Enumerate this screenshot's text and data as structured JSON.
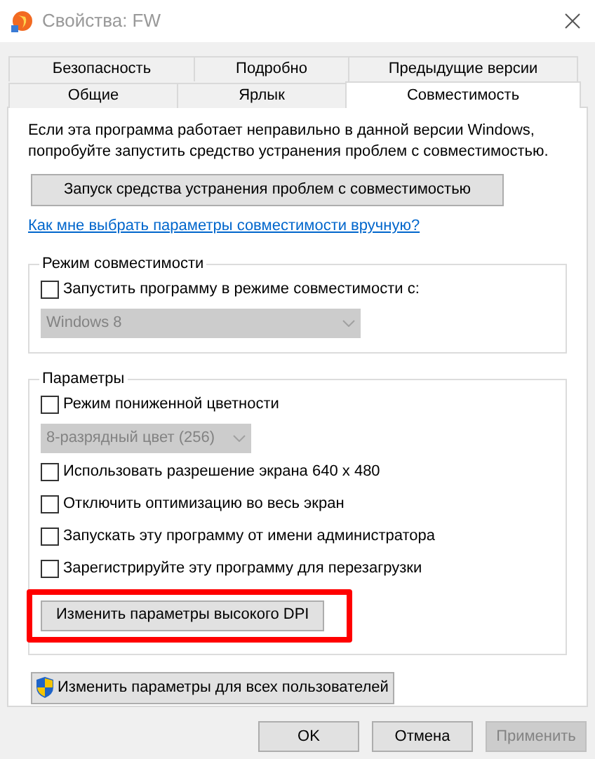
{
  "window": {
    "title": "Свойства: FW"
  },
  "tab_rows": [
    [
      {
        "label": "Безопасность",
        "selected": false
      },
      {
        "label": "Подробно",
        "selected": false
      },
      {
        "label": "Предыдущие версии",
        "selected": false
      }
    ],
    [
      {
        "label": "Общие",
        "selected": false
      },
      {
        "label": "Ярлык",
        "selected": false
      },
      {
        "label": "Совместимость",
        "selected": true
      }
    ]
  ],
  "intro": "Если эта программа работает неправильно в данной версии Windows, попробуйте запустить средство устранения проблем с совместимостью.",
  "troubleshooter_button": "Запуск средства устранения проблем с совместимостью",
  "help_link": "Как мне выбрать параметры совместимости вручную?",
  "compat_group": {
    "title": "Режим совместимости",
    "items": [
      {
        "kind": "checkbox",
        "label": "Запустить программу в режиме совместимости с:",
        "checked": false
      },
      {
        "kind": "dropdown",
        "value": "Windows 8",
        "disabled": true,
        "wide": true
      }
    ]
  },
  "settings_group": {
    "title": "Параметры",
    "items": [
      {
        "kind": "checkbox",
        "label": "Режим пониженной цветности",
        "checked": false
      },
      {
        "kind": "dropdown",
        "value": "8-разрядный цвет (256)",
        "disabled": true,
        "wide": false
      },
      {
        "kind": "checkbox",
        "label": "Использовать разрешение экрана 640 x 480",
        "checked": false
      },
      {
        "kind": "checkbox",
        "label": "Отключить оптимизацию во весь экран",
        "checked": false
      },
      {
        "kind": "checkbox",
        "label": "Запускать эту программу от имени администратора",
        "checked": false
      },
      {
        "kind": "checkbox",
        "label": "Зарегистрируйте эту программу для перезагрузки",
        "checked": false
      },
      {
        "kind": "button",
        "label": "Изменить параметры высокого DPI",
        "highlighted": true
      }
    ]
  },
  "all_users_button": "Изменить параметры для всех пользователей",
  "buttons": [
    {
      "label": "OK",
      "disabled": false
    },
    {
      "label": "Отмена",
      "disabled": false
    },
    {
      "label": "Применить",
      "disabled": true
    }
  ]
}
